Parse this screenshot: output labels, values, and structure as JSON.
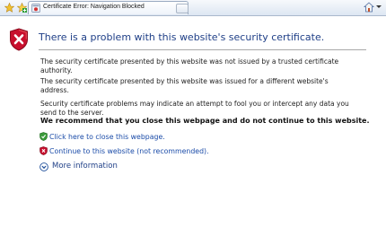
{
  "tab": {
    "label": "Certificate Error: Navigation Blocked"
  },
  "page": {
    "title": "There is a problem with this website's security certificate.",
    "paragraph1": "The security certificate presented by this website was not issued by a trusted certificate authority.",
    "paragraph2": "The security certificate presented by this website was issued for a different website's address.",
    "paragraph3": "Security certificate problems may indicate an attempt to fool you or intercept any data you send to the server.",
    "recommendation": "We recommend that you close this webpage and do not continue to this website.",
    "close_link": "Click here to close this webpage.",
    "continue_link": "Continue to this website (not recommended).",
    "more_info": "More information"
  },
  "colors": {
    "title": "#1f3f87",
    "link": "#1a4ba8",
    "shield_red": "#c8102e",
    "shield_green": "#3a9a3a"
  },
  "icons": {
    "favorites": "favorites-star-icon",
    "add_favorites": "add-favorites-icon",
    "tab": "certificate-error-icon",
    "home": "home-icon",
    "shield": "red-shield-x-icon",
    "close_option": "green-shield-icon",
    "continue_option": "red-shield-icon",
    "more_info": "expand-chevron-icon"
  }
}
